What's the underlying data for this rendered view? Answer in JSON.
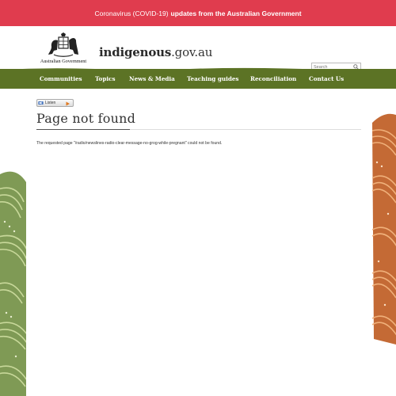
{
  "banner": {
    "prefix": "Coronavirus (COVID-19)",
    "link_text": "updates from the Australian Government"
  },
  "header": {
    "gov_logo_text": "Australian Government",
    "site_title_bold": "indigenous",
    "site_title_rest": ".gov.au",
    "search_placeholder": "Search",
    "social_icons": [
      "facebook-icon",
      "instagram-icon",
      "twitter-icon",
      "youtube-icon",
      "email-icon",
      "rss-icon"
    ]
  },
  "nav": {
    "items": [
      {
        "label": "Communities"
      },
      {
        "label": "Topics"
      },
      {
        "label": "News & Media"
      },
      {
        "label": "Teaching guides"
      },
      {
        "label": "Reconciliation"
      },
      {
        "label": "Contact Us"
      }
    ]
  },
  "content": {
    "listen_label": "Listen",
    "page_title": "Page not found",
    "message": "The requested page \"/radio/newslines-radio-clear-message-no-grog-while-pregnant\" could not be found."
  },
  "colors": {
    "banner": "#e03c4e",
    "nav": "#5c7325",
    "art_left": "#7f9a55",
    "art_right": "#c46a35"
  }
}
